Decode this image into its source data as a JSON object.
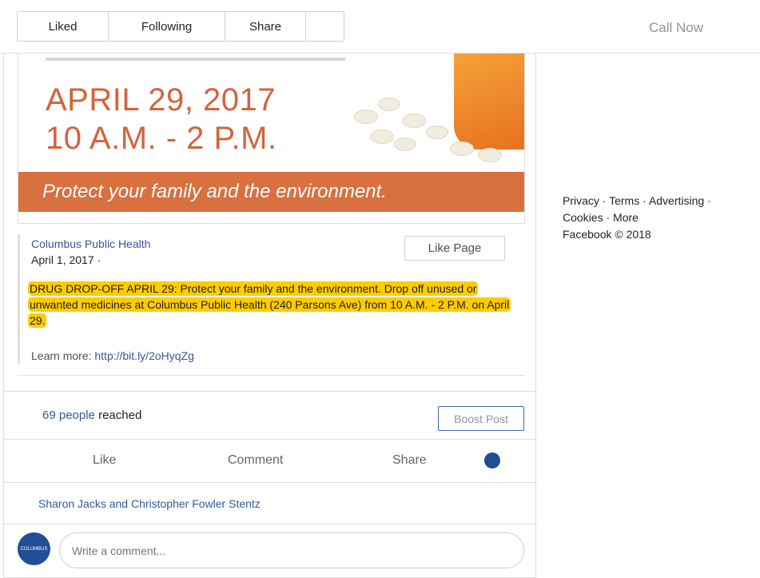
{
  "topbar": {
    "buttons": [
      {
        "label": "Liked"
      },
      {
        "label": "Following"
      },
      {
        "label": "Share"
      },
      {
        "label": ""
      }
    ],
    "call_now": "Call Now"
  },
  "banner": {
    "date_line1": "APRIL 29, 2017",
    "date_line2": "10 A.M. - 2 P.M.",
    "tagline": "Protect your family and the environment."
  },
  "shared_post": {
    "page_name": "Columbus Public Health",
    "date": "April 1, 2017 ·",
    "like_page_label": "Like Page",
    "text": "DRUG DROP-OFF APRIL 29: Protect your family and the environment. Drop off unused or unwanted medicines at Columbus Public Health (240 Parsons Ave) from 10 A.M. - 2 P.M. on April 29.",
    "learn_more_label": "Learn more:",
    "learn_more_link": "http://bit.ly/2oHyqZg"
  },
  "reach": {
    "count": "69 people",
    "suffix": "reached",
    "boost_label": "Boost Post"
  },
  "actions": {
    "like": "Like",
    "comment": "Comment",
    "share": "Share"
  },
  "likers": "Sharon Jacks and Christopher Fowler Stentz",
  "comment": {
    "placeholder": "Write a comment...",
    "avatar_text": "COLUMBUS"
  },
  "footer": {
    "privacy": "Privacy",
    "terms": "Terms",
    "advertising": "Advertising",
    "cookies": "Cookies",
    "more": "More",
    "copyright": "Facebook © 2018",
    "separator": "·"
  },
  "colors": {
    "link": "#365899",
    "highlight": "#ffcc00",
    "banner_orange": "#d8703f"
  }
}
